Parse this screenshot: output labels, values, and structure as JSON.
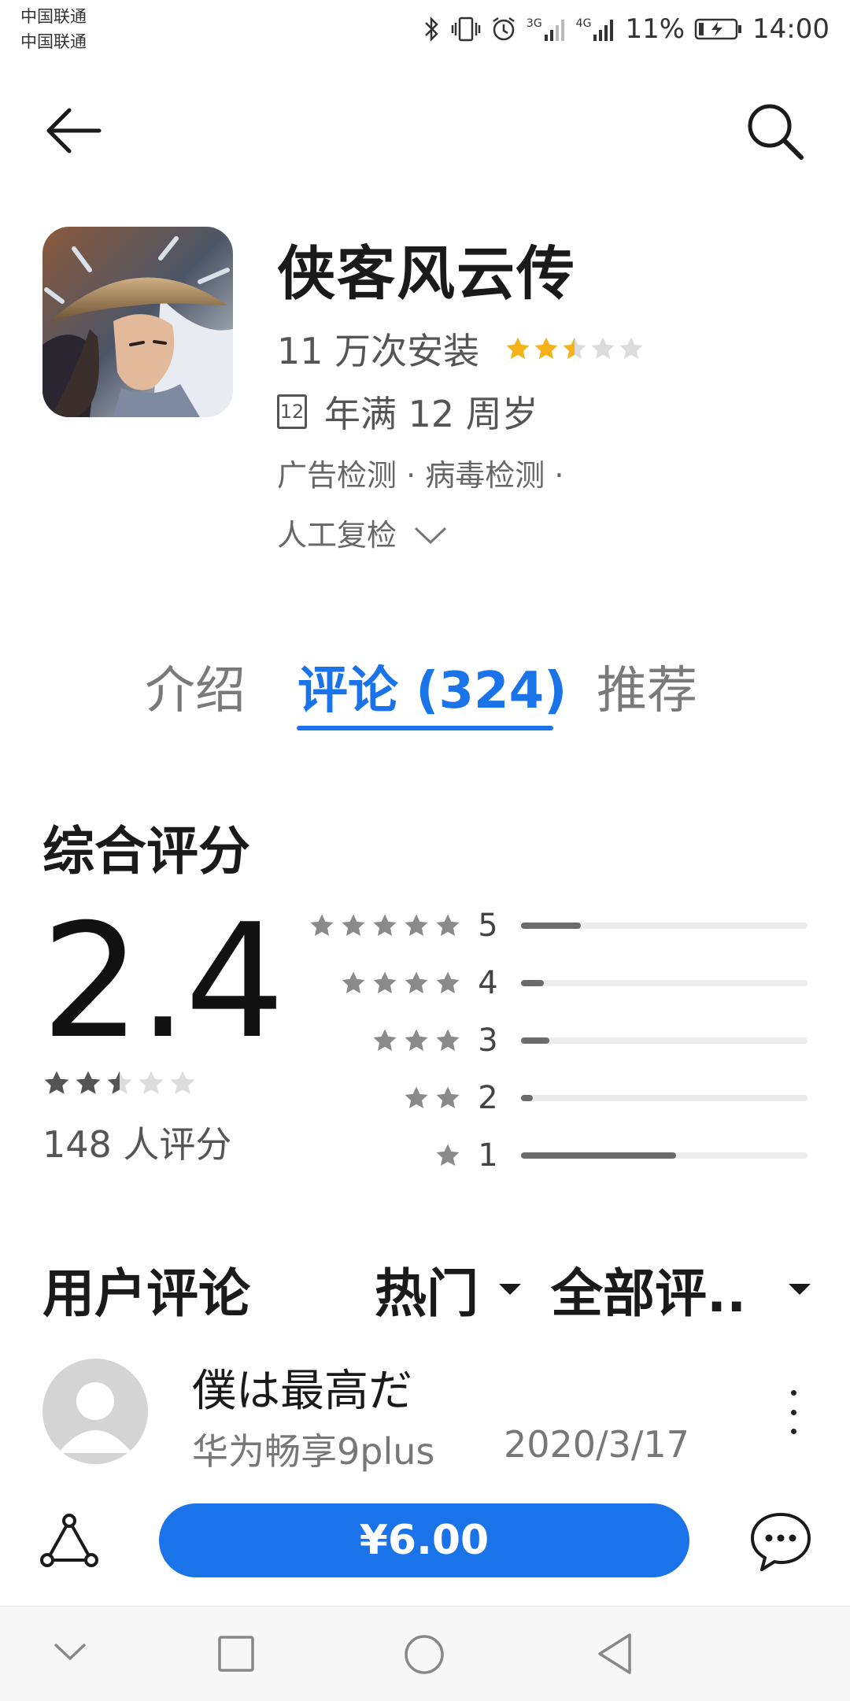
{
  "status_bar": {
    "carrier_1": "中国联通",
    "carrier_2": "中国联通",
    "network_1": "3G",
    "network_2": "4G",
    "battery": "11%",
    "time": "14:00"
  },
  "header": {
    "back_icon": "arrow-left-icon",
    "search_icon": "search-icon"
  },
  "app": {
    "name": "侠客风云传",
    "installs": "11 万次安装",
    "rating_stars": 2.5,
    "age_badge": "12",
    "age_text": "年满 12 周岁",
    "checks_line1": "广告检测 · 病毒检测 ·",
    "checks_line2": "人工复检"
  },
  "tabs": {
    "intro": "介绍",
    "reviews": "评论 (324)",
    "recommend": "推荐",
    "active": "reviews"
  },
  "rating": {
    "section_title": "综合评分",
    "score": "2.4",
    "stars": 2.5,
    "count": "148 人评分",
    "distribution": [
      {
        "label": "5",
        "stars": 5,
        "fraction": 0.21
      },
      {
        "label": "4",
        "stars": 4,
        "fraction": 0.08
      },
      {
        "label": "3",
        "stars": 3,
        "fraction": 0.1
      },
      {
        "label": "2",
        "stars": 2,
        "fraction": 0.04
      },
      {
        "label": "1",
        "stars": 1,
        "fraction": 0.54
      }
    ]
  },
  "reviews": {
    "title": "用户评论",
    "sort": "热门",
    "filter": "全部评..",
    "items": [
      {
        "user": "僕は最高だ",
        "device": "华为畅享9plus",
        "date": "2020/3/17"
      }
    ]
  },
  "action_bar": {
    "price": "¥6.00",
    "share_icon": "share-icon",
    "comment_icon": "comment-icon"
  },
  "colors": {
    "accent": "#1a73e8",
    "star_filled": "#f6b21b",
    "star_empty": "#dcdcdc",
    "bar_fill": "#6b6b6b"
  }
}
